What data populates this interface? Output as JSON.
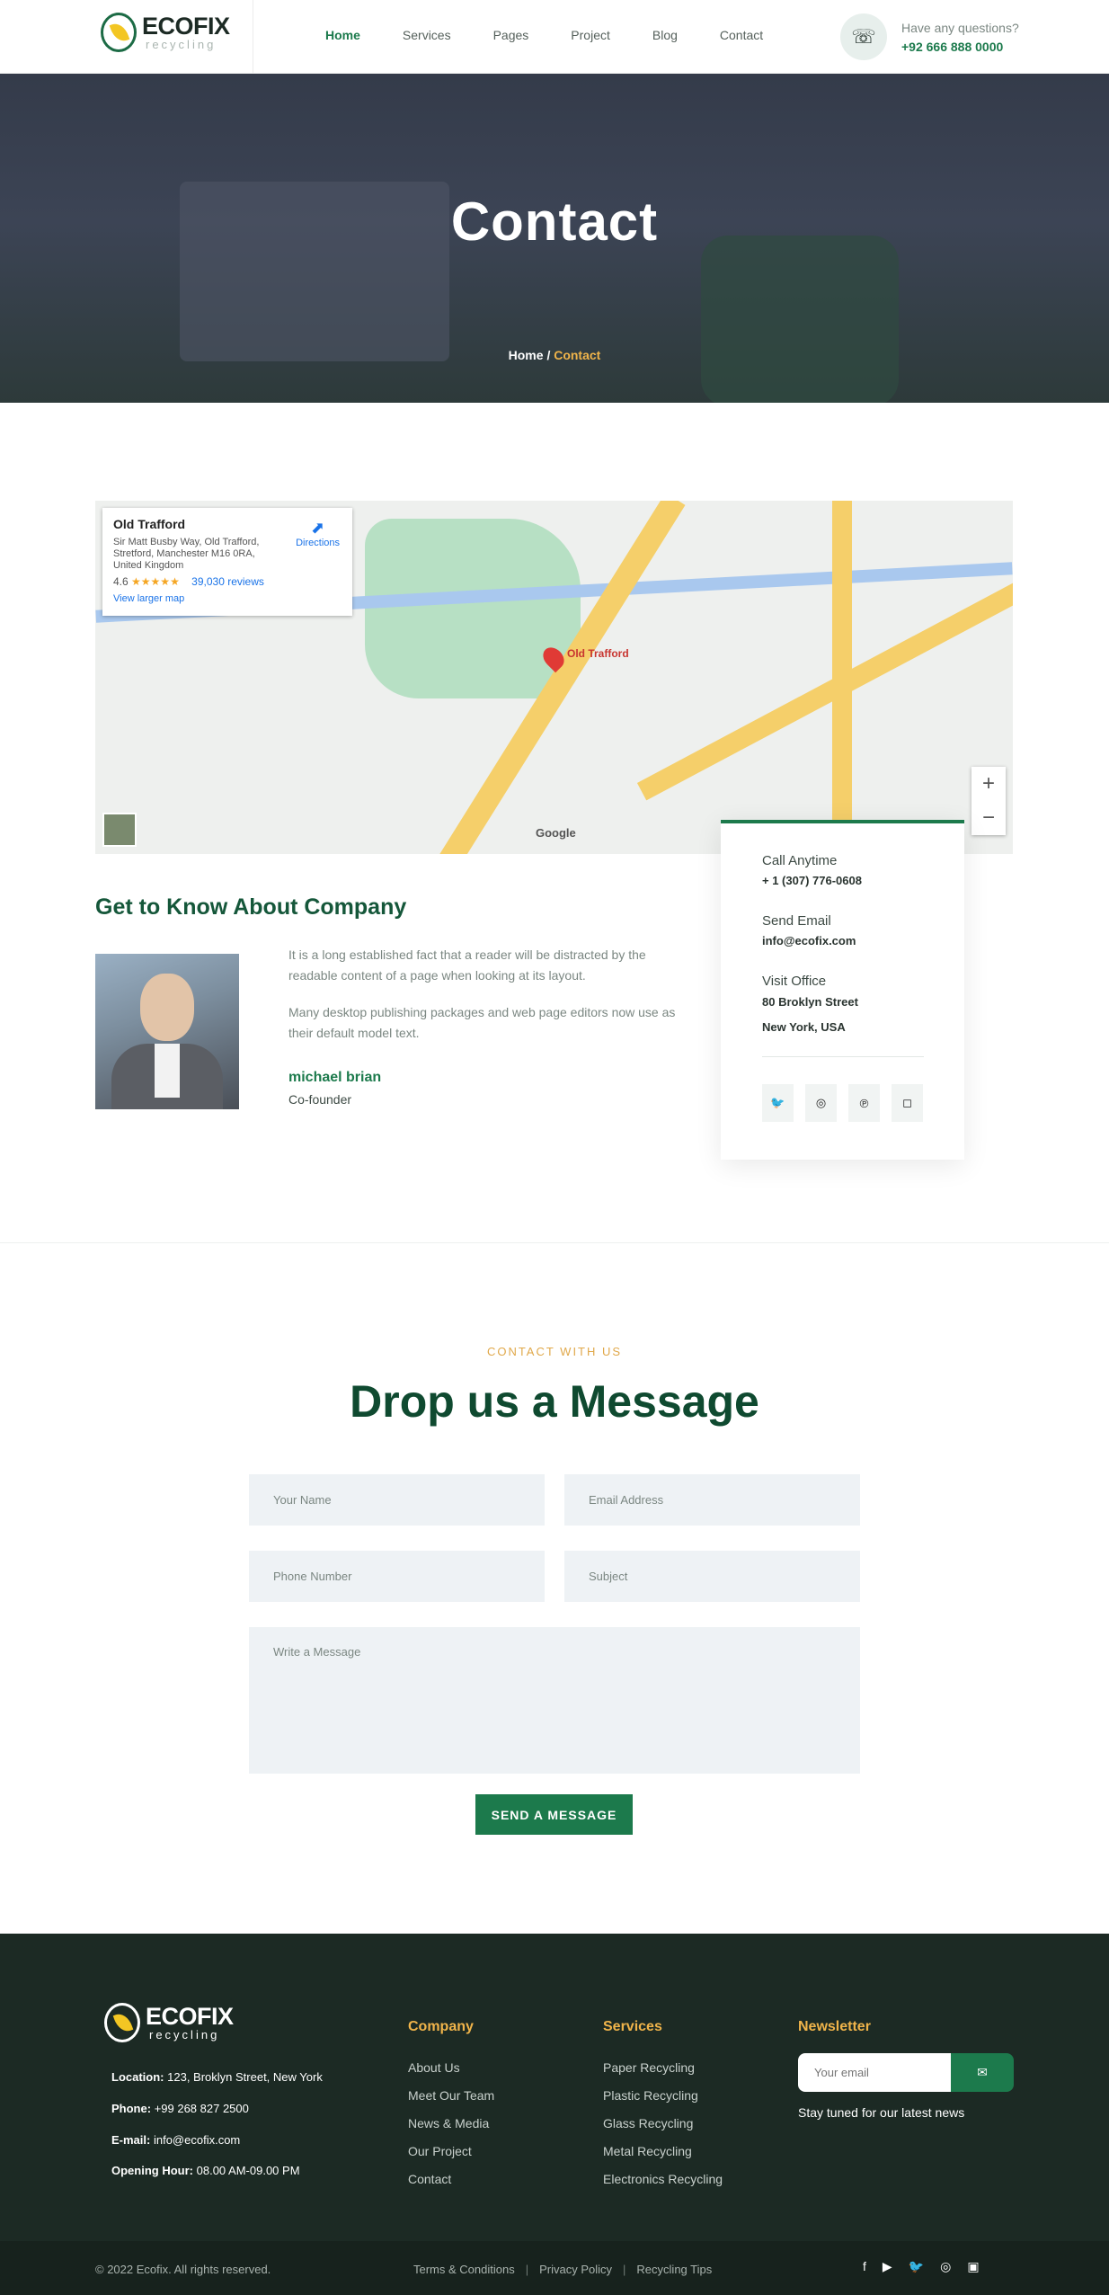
{
  "header": {
    "logo_name": "ECOFIX",
    "logo_sub": "recycling",
    "nav": [
      "Home",
      "Services",
      "Pages",
      "Project",
      "Blog",
      "Contact"
    ],
    "question": "Have any questions?",
    "phone": "+92 666 888 0000"
  },
  "hero": {
    "title": "Contact",
    "crumb_home": "Home",
    "crumb_sep": "/",
    "crumb_current": "Contact"
  },
  "map": {
    "place": "Old Trafford",
    "address": "Sir Matt Busby Way, Old Trafford, Stretford, Manchester M16 0RA, United Kingdom",
    "rating": "4.6",
    "stars": "★★★★★",
    "reviews": "39,030 reviews",
    "larger_map": "View larger map",
    "directions": "Directions",
    "pin_label": "Old Trafford",
    "google": "Google"
  },
  "about": {
    "title": "Get to Know About Company",
    "p1": "It is a long established fact that a reader will be distracted by the readable content of a page when looking at its layout.",
    "p2": "Many desktop publishing packages and web page editors now use as their default model text.",
    "name": "michael brian",
    "role": "Co-founder"
  },
  "contact_card": {
    "call_label": "Call Anytime",
    "call_value": "+ 1 (307) 776-0608",
    "email_label": "Send Email",
    "email_value": "info@ecofix.com",
    "office_label": "Visit Office",
    "office_line1": "80 Broklyn Street",
    "office_line2": "New York, USA"
  },
  "form": {
    "eyebrow": "CONTACT WITH US",
    "title": "Drop us a Message",
    "name_ph": "Your Name",
    "email_ph": "Email Address",
    "phone_ph": "Phone Number",
    "subject_ph": "Subject",
    "message_ph": "Write a Message",
    "submit": "SEND A MESSAGE"
  },
  "footer": {
    "logo_name": "ECOFIX",
    "logo_sub": "recycling",
    "location_label": "Location:",
    "location": "123, Broklyn Street, New York",
    "phone_label": "Phone:",
    "phone": "+99 268 827 2500",
    "email_label": "E-mail:",
    "email": "info@ecofix.com",
    "hours_label": "Opening Hour:",
    "hours": "08.00 AM-09.00 PM",
    "company_title": "Company",
    "company_links": [
      "About Us",
      "Meet Our Team",
      "News & Media",
      "Our Project",
      "Contact"
    ],
    "services_title": "Services",
    "services_links": [
      "Paper Recycling",
      "Plastic Recycling",
      "Glass Recycling",
      "Metal Recycling",
      "Electronics Recycling"
    ],
    "newsletter_title": "Newsletter",
    "newsletter_ph": "Your email",
    "newsletter_note": "Stay tuned for our latest news"
  },
  "bottom": {
    "copyright": "© 2022 Ecofix. All rights reserved.",
    "terms": "Terms & Conditions",
    "privacy": "Privacy Policy",
    "tips": "Recycling Tips",
    "sep": "|"
  }
}
